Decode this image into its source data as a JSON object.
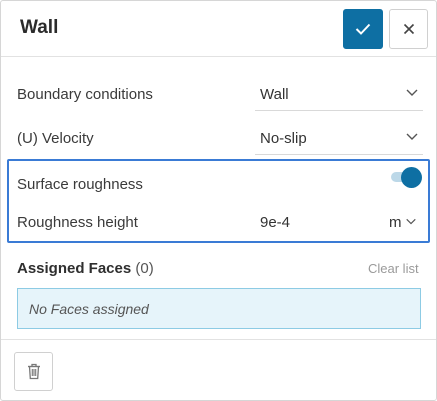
{
  "header": {
    "title": "Wall",
    "confirm_icon": "checkmark-icon",
    "close_icon": "close-icon"
  },
  "form": {
    "boundary_conditions": {
      "label": "Boundary conditions",
      "value": "Wall"
    },
    "velocity": {
      "label": "(U) Velocity",
      "value": "No-slip"
    },
    "surface_roughness": {
      "label": "Surface roughness",
      "enabled": true
    },
    "roughness_height": {
      "label": "Roughness height",
      "value": "9e-4",
      "unit": "m"
    }
  },
  "assigned_faces": {
    "title": "Assigned Faces",
    "count": "(0)",
    "clear_label": "Clear list",
    "empty_text": "No Faces assigned"
  },
  "footer": {
    "delete_icon": "trash-icon"
  },
  "colors": {
    "accent": "#0e6fa3",
    "highlight_border": "#3a7bd5",
    "faces_bg": "#e6f4fa",
    "faces_border": "#8dcbe4"
  }
}
